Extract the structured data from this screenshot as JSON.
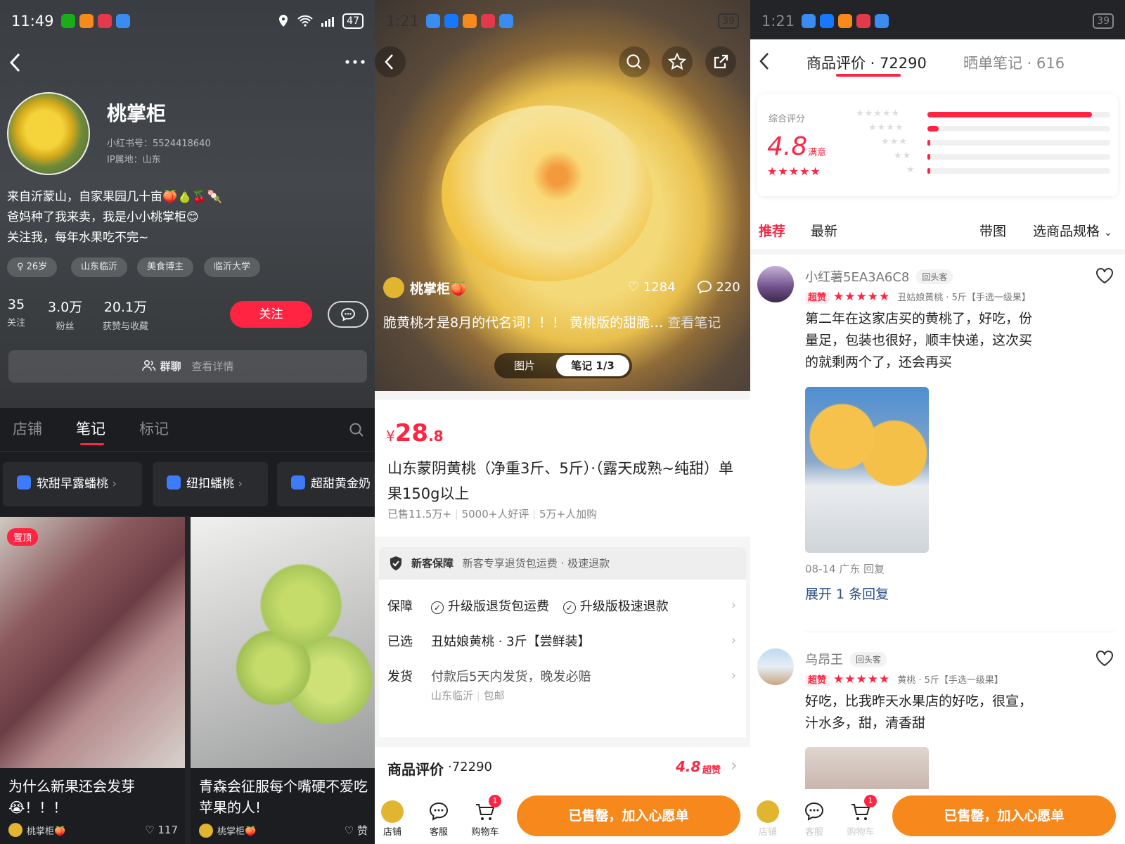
{
  "status": {
    "p1_time": "11:49",
    "p2_time": "1:21",
    "p3_time": "1:21",
    "battery1": "47",
    "battery2": "39",
    "battery3": "39"
  },
  "profile": {
    "name": "桃掌柜",
    "red_id": "小红书号：5524418640",
    "ip": "IP属地：山东",
    "bio": [
      "来自沂蒙山，自家果园几十亩🍑🍐🍒🍡",
      "爸妈种了我来卖，我是小小桃掌柜😊",
      "关注我，每年水果吃不完~"
    ],
    "tags": [
      "♀ 26岁",
      "山东临沂",
      "美食博主",
      "临沂大学"
    ],
    "stats": [
      {
        "n": "35",
        "l": "关注"
      },
      {
        "n": "3.0万",
        "l": "粉丝"
      },
      {
        "n": "20.1万",
        "l": "获赞与收藏"
      }
    ],
    "follow": "关注",
    "group_label": "群聊",
    "group_more": "查看详情",
    "tabs": [
      "店铺",
      "笔记",
      "标记"
    ],
    "collections": [
      "软甜早露蟠桃",
      "纽扣蟠桃",
      "超甜黄金奶"
    ],
    "cards": [
      {
        "pin": "置顶",
        "title": "为什么新果还会发芽😭！！！",
        "author": "桃掌柜🍑",
        "likes": "117"
      },
      {
        "title": "青森会征服每个嘴硬不爱吃苹果的人!",
        "author": "桃掌柜🍑",
        "likes": "赞"
      }
    ]
  },
  "product": {
    "author": "桃掌柜🍑",
    "likes": "1284",
    "comments": "220",
    "caption": "脆黄桃才是8月的代名词！！！ 黄桃版的甜脆…",
    "caption_more": "查看笔记",
    "seg_pic": "图片",
    "seg_note": "笔记 1/3",
    "price_symbol": "¥",
    "price_int": "28",
    "price_dec": ".8",
    "title": "山东蒙阴黄桃（净重3斤、5斤）·（露天成熟~纯甜）单果150g以上",
    "sold": "已售11.5万+",
    "good": "5000+人好评",
    "cart": "5万+人加购",
    "guard_title": "新客保障",
    "guard_text": "新客专享退货包运费 · 极速退款",
    "rows": [
      {
        "k": "保障",
        "v": "升级版退货包运费",
        "v2": "升级版极速退款"
      },
      {
        "k": "已选",
        "v": "丑姑娘黄桃 · 3斤【尝鲜装】"
      },
      {
        "k": "发货",
        "v": "付款后5天内发货，晚发必赔",
        "sub1": "山东临沂",
        "sub2": "包邮"
      }
    ],
    "review_title": "商品评价",
    "review_count": "·72290",
    "review_score": "4.8",
    "review_super": "超赞"
  },
  "bottom": {
    "shop": "店铺",
    "service": "客服",
    "cart": "购物车",
    "cart_badge": "1",
    "button": "已售罄，加入心愿单"
  },
  "reviews": {
    "tab1": "商品评价 · 72290",
    "tab2": "晒单笔记 · 616",
    "overall_label": "综合评分",
    "score": "4.8",
    "score_word": "满意",
    "dist": [
      0.9,
      0.06,
      0.01,
      0.01,
      0.01
    ],
    "sort": [
      "推荐",
      "最新",
      "带图",
      "选商品规格"
    ],
    "items": [
      {
        "user": "小红薯5EA3A6C8",
        "badge": "回头客",
        "super": "超赞",
        "stars": "★★★★★",
        "spec": "丑姑娘黄桃 · 5斤【手选一级果】",
        "text": "第二年在这家店买的黄桃了，好吃，份量足，包装也很好，顺丰快递，这次买的就剩两个了，还会再买",
        "date": "08-14 广东 回复",
        "more": "展开 1 条回复"
      },
      {
        "user": "乌昂王",
        "badge": "回头客",
        "super": "超赞",
        "stars": "★★★★★",
        "spec": "黄桃 · 5斤【手选一级果】",
        "text": "好吃，比我昨天水果店的好吃，很宣，汁水多，甜，清香甜"
      }
    ]
  }
}
